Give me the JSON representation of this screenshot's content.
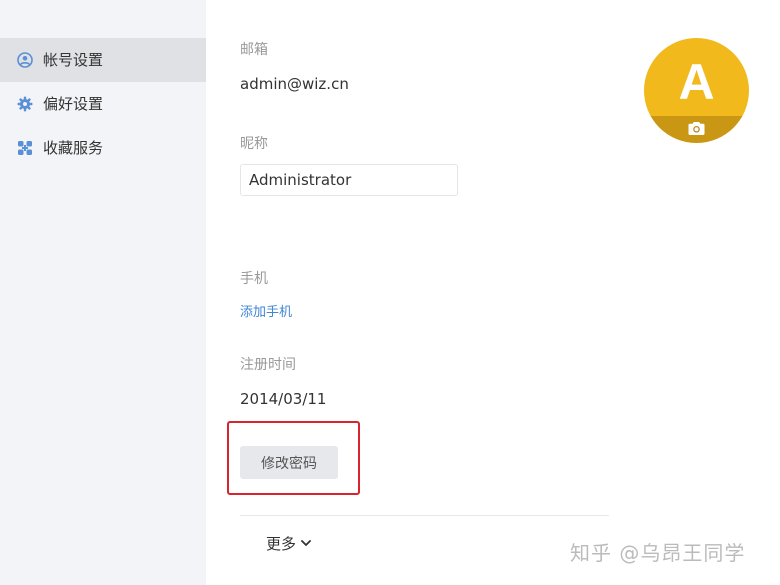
{
  "sidebar": {
    "items": [
      {
        "label": "帐号设置",
        "icon": "user-icon",
        "active": true
      },
      {
        "label": "偏好设置",
        "icon": "gear-icon",
        "active": false
      },
      {
        "label": "收藏服务",
        "icon": "grid-icon",
        "active": false
      }
    ]
  },
  "profile": {
    "email_label": "邮箱",
    "email_value": "admin@wiz.cn",
    "nickname_label": "昵称",
    "nickname_value": "Administrator",
    "phone_label": "手机",
    "add_phone_link": "添加手机",
    "registered_label": "注册时间",
    "registered_value": "2014/03/11",
    "change_password_button": "修改密码",
    "more_label": "更多",
    "avatar_letter": "A",
    "avatar_overlay_icon": "camera-icon"
  },
  "colors": {
    "avatar_bg": "#f2b91c",
    "link": "#3e86d6",
    "highlight": "#d9232d",
    "sidebar_bg": "#f3f4f7",
    "sidebar_active": "#dfe1e5"
  },
  "watermark": "知乎 @乌昂王同学"
}
